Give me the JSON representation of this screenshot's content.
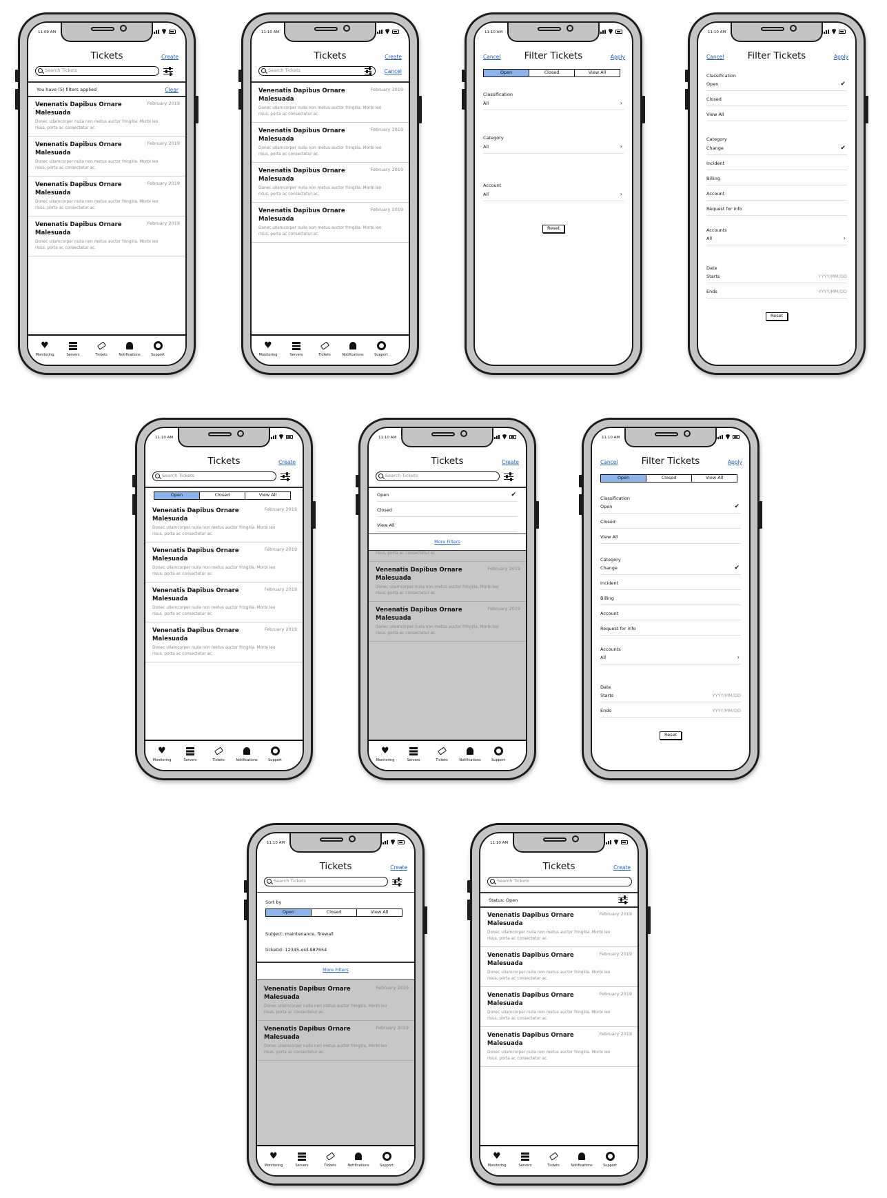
{
  "status_times": {
    "first": "11:09 AM",
    "other": "11:10 AM"
  },
  "tickets_title": "Tickets",
  "filter_title": "Filter Tickets",
  "links": {
    "create": "Create",
    "cancel": "Cancel",
    "apply": "Apply",
    "clear": "Clear",
    "more_filters": "More Filters"
  },
  "search_placeholder": "Search Tickets",
  "filters_applied": "You have (5) filters applied",
  "status_open": "Status: Open",
  "ticket": {
    "title": "Venenatis Dapibus Ornare Malesuada",
    "date": "February 2019",
    "desc": "Donec ullamcorper nulla non metus auctor fringilla. Morbi leo risus, porta ac consectetur ac."
  },
  "segments": [
    "Open",
    "Closed",
    "View All"
  ],
  "tabs": [
    "Monitoring",
    "Servers",
    "Tickets",
    "Notifications",
    "Support"
  ],
  "filter": {
    "classification": "Classification",
    "category": "Category",
    "account": "Account",
    "accounts": "Accounts",
    "all": "All",
    "date": "Date",
    "starts": "Starts",
    "ends": "Ends",
    "date_placeholder": "YYYY/MM/DD",
    "reset": "Reset",
    "class_options": [
      "Open",
      "Closed",
      "View All"
    ],
    "category_options": [
      "Change",
      "Incident",
      "Billing",
      "Account",
      "Request for info"
    ]
  },
  "sort": {
    "label": "Sort by",
    "subject": "Subject: maintenance, firewall",
    "ticket_id": "ticketId: 12345-ord-987654"
  },
  "colors": {
    "accent": "#8cb4ea",
    "link": "#1a5fc8",
    "overlay": "#c7c7c7"
  }
}
